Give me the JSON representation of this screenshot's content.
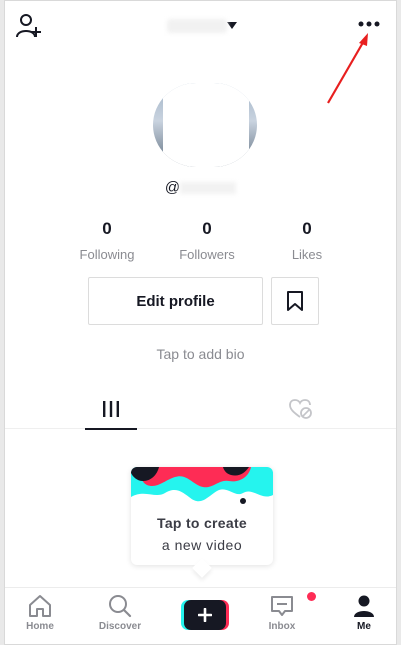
{
  "header": {
    "add_user_icon": "add-user-icon",
    "more_icon": "more-horizontal-icon",
    "dropdown_icon": "caret-down-icon"
  },
  "profile": {
    "handle_prefix": "@",
    "stats": [
      {
        "value": "0",
        "label": "Following"
      },
      {
        "value": "0",
        "label": "Followers"
      },
      {
        "value": "0",
        "label": "Likes"
      }
    ],
    "edit_profile_label": "Edit profile",
    "bio_placeholder": "Tap to add bio"
  },
  "tabs": {
    "videos_icon": "grid-bars-icon",
    "liked_icon": "liked-heart-icon"
  },
  "create_prompt": {
    "line1": "Tap to create",
    "line2": "a new video"
  },
  "bottom_nav": {
    "items": [
      {
        "label": "Home",
        "icon": "home-icon"
      },
      {
        "label": "Discover",
        "icon": "search-icon"
      },
      {
        "label": "",
        "icon": "plus-icon"
      },
      {
        "label": "Inbox",
        "icon": "inbox-icon"
      },
      {
        "label": "Me",
        "icon": "person-icon"
      }
    ]
  },
  "colors": {
    "annotation_arrow": "#e81f1f",
    "accent_pink": "#fe2c55",
    "accent_cyan": "#25f4ee",
    "text_primary": "#161823",
    "text_secondary": "#8a8b91"
  }
}
